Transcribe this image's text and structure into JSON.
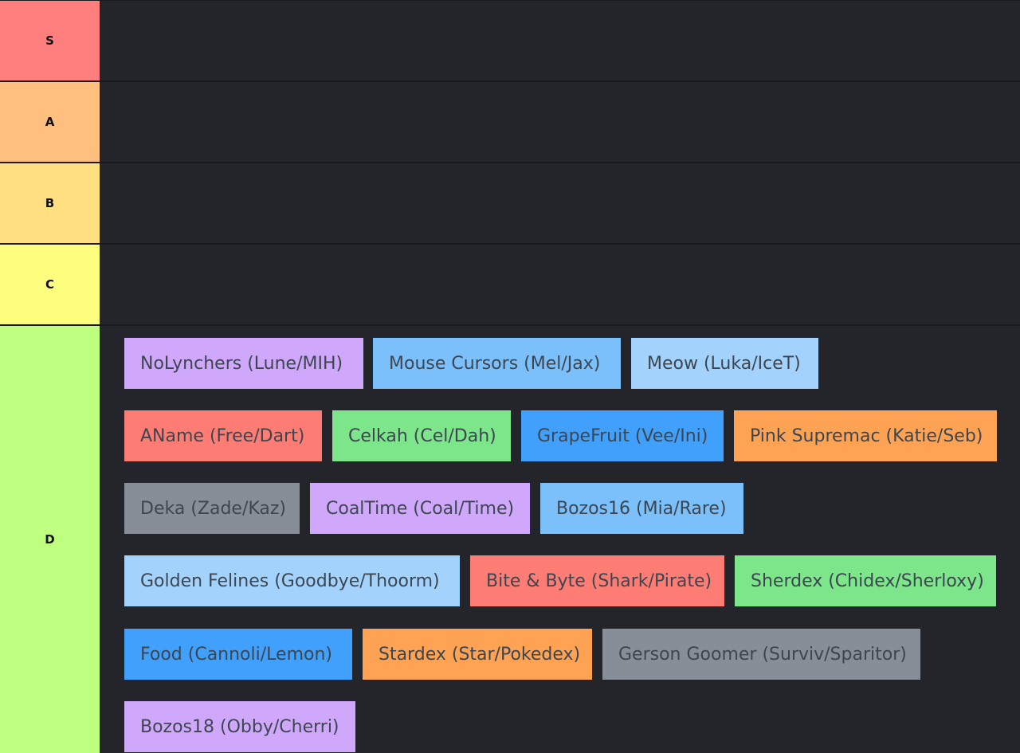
{
  "tiers": [
    {
      "label": "S",
      "color": "#ff7f7f"
    },
    {
      "label": "A",
      "color": "#ffbf7f"
    },
    {
      "label": "B",
      "color": "#ffdf7f"
    },
    {
      "label": "C",
      "color": "#ffff7f"
    },
    {
      "label": "D",
      "color": "#bfff7f"
    }
  ],
  "items": [
    {
      "text": "NoLynchers (Lune/MIH)",
      "color": "#cfa8fb"
    },
    {
      "text": "Mouse Cursors (Mel/Jax)",
      "color": "#7bc0fb"
    },
    {
      "text": "Meow (Luka/IceT)",
      "color": "#a3d3fd"
    },
    {
      "text": "AName (Free/Dart)",
      "color": "#fd7d74"
    },
    {
      "text": "Celkah (Cel/Dah)",
      "color": "#7de58a"
    },
    {
      "text": "GrapeFruit (Vee/Ini)",
      "color": "#40a0fc"
    },
    {
      "text": "Pink Supremac (Katie/Seb)",
      "color": "#fea353"
    },
    {
      "text": "Deka (Zade/Kaz)",
      "color": "#878e97"
    },
    {
      "text": "CoalTime (Coal/Time)",
      "color": "#cfa8fb"
    },
    {
      "text": "Bozos16 (Mia/Rare)",
      "color": "#7bc0fb"
    },
    {
      "text": "Golden Felines (Goodbye/Thoorm)",
      "color": "#a3d3fd"
    },
    {
      "text": "Bite & Byte (Shark/Pirate)",
      "color": "#fd7d74"
    },
    {
      "text": "Sherdex (Chidex/Sherloxy)",
      "color": "#7de58a"
    },
    {
      "text": "Food (Cannoli/Lemon)",
      "color": "#40a0fc"
    },
    {
      "text": "Stardex (Star/Pokedex)",
      "color": "#fea353"
    },
    {
      "text": "Gerson Goomer (Surviv/Sparitor)",
      "color": "#878e97"
    },
    {
      "text": "Bozos18 (Obby/Cherri)",
      "color": "#cfa8fb"
    }
  ]
}
